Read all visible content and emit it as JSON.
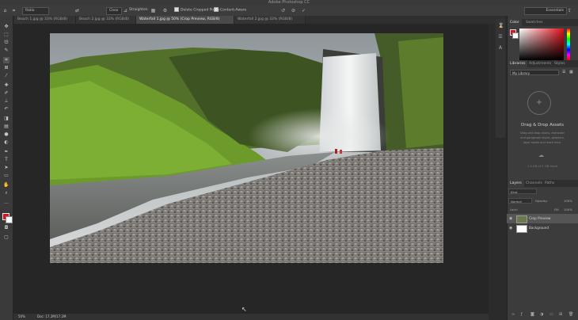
{
  "app_title": "Adobe Photoshop CC",
  "options_bar": {
    "ratio_select": "Ratio",
    "clear_label": "Clear",
    "straighten_label": "Straighten",
    "delete_cropped_label": "Delete Cropped Pixels",
    "content_aware_label": "Content-Aware",
    "workspace_select": "Essentials"
  },
  "tabs": [
    {
      "label": "Beach 1.jpg @ 33% (RGB/8)"
    },
    {
      "label": "Beach 2.jpg @ 33% (RGB/8)"
    },
    {
      "label": "Waterfall 1.jpg @ 50% (Crop Preview, RGB/8)"
    },
    {
      "label": "Waterfall 2.jpg @ 33% (RGB/8)"
    }
  ],
  "status": {
    "zoom": "50%",
    "doc_info": "Doc: 17.2M/17.2M"
  },
  "color_panel": {
    "tabs": [
      "Color",
      "Swatches"
    ],
    "colors": {
      "foreground": "#d3161b",
      "background": "#ffffff"
    }
  },
  "libraries_panel": {
    "tabs": [
      "Libraries",
      "Adjustments",
      "Styles"
    ],
    "library_select": "My Library",
    "title": "Drag & Drop Assets",
    "desc_lines": [
      "Drag and drop colors, character",
      "and paragraph styles, graphics,",
      "layer styles and more here."
    ],
    "storage": "1.5 KB of 2 GB Used"
  },
  "layers_panel": {
    "tabs": [
      "Layers",
      "Channels",
      "Paths"
    ],
    "kind_select": "Kind",
    "blend_mode": "Normal",
    "opacity_label": "Opacity:",
    "opacity_value": "100%",
    "lock_label": "Lock:",
    "fill_label": "Fill:",
    "fill_value": "100%",
    "layers": [
      {
        "name": "Crop Preview",
        "selected": true
      },
      {
        "name": "Background",
        "selected": false
      }
    ]
  }
}
